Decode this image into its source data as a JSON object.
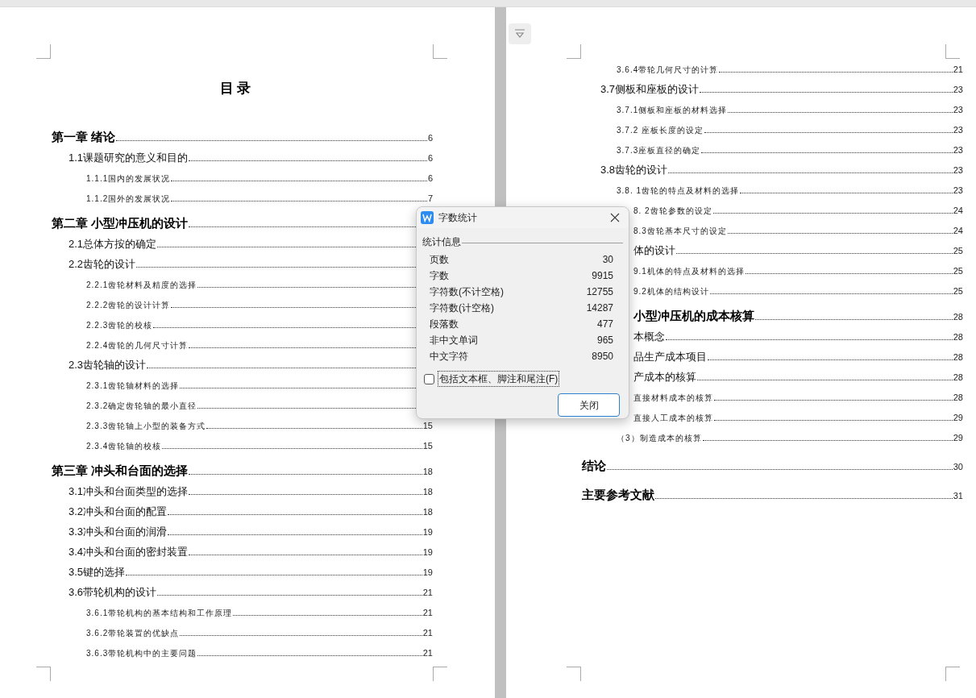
{
  "left_page": {
    "title": "目 录",
    "chapters": [
      {
        "title": "第一章  绪论",
        "page": "6",
        "children": [
          {
            "title": "1.1课题研究的意义和目的",
            "page": "6",
            "children": [
              {
                "title": "1.1.1国内的发展状况",
                "page": "6"
              },
              {
                "title": "1.1.2国外的发展状况",
                "page": "7"
              }
            ]
          }
        ]
      },
      {
        "title": "第二章  小型冲压机的设计",
        "children": [
          {
            "title": "2.1总体方按的确定"
          },
          {
            "title": "2.2齿轮的设计",
            "children": [
              {
                "title": "2.2.1齿轮材料及精度的选择"
              },
              {
                "title": "2.2.2齿轮的设计计算"
              },
              {
                "title": "2.2.3齿轮的校核"
              },
              {
                "title": "2.2.4齿轮的几何尺寸计算"
              }
            ]
          },
          {
            "title": "2.3齿轮轴的设计",
            "children": [
              {
                "title": "2.3.1齿轮轴材料的选择"
              },
              {
                "title": "2.3.2确定齿轮轴的最小直径"
              },
              {
                "title": "2.3.3齿轮轴上小型的装备方式",
                "page": "15"
              },
              {
                "title": "2.3.4齿轮轴的校核",
                "page": "15"
              }
            ]
          }
        ]
      },
      {
        "title": "第三章  冲头和台面的选择",
        "page": "18",
        "children": [
          {
            "title": "3.1冲头和台面类型的选择",
            "page": "18"
          },
          {
            "title": "3.2冲头和台面的配置",
            "page": "18"
          },
          {
            "title": "3.3冲头和台面的润滑",
            "page": "19"
          },
          {
            "title": "3.4冲头和台面的密封装置",
            "page": "19"
          },
          {
            "title": "3.5键的选择",
            "page": "19"
          },
          {
            "title": "3.6带轮机构的设计",
            "page": "21",
            "children": [
              {
                "title": "3.6.1带轮机构的基本结构和工作原理",
                "page": "21"
              },
              {
                "title": "3.6.2带轮装置的优缺点",
                "page": "21"
              },
              {
                "title": "3.6.3带轮机构中的主要问题",
                "page": "21"
              }
            ]
          }
        ]
      }
    ]
  },
  "right_page": {
    "continued_subsections": [
      {
        "title": "3.6.4带轮几何尺寸的计算",
        "page": "21"
      }
    ],
    "continued_sections": [
      {
        "title": "3.7侧板和座板的设计",
        "page": "23",
        "children": [
          {
            "title": "3.7.1侧板和座板的材料选择",
            "page": "23"
          },
          {
            "title": "3.7.2 座板长度的设定",
            "page": "23"
          },
          {
            "title": "3.7.3座板直径的确定",
            "page": "23"
          }
        ]
      },
      {
        "title": "3.8齿轮的设计",
        "page": "23",
        "children": [
          {
            "title": "3.8. 1齿轮的特点及材料的选择",
            "page": "23"
          },
          {
            "title": "8. 2齿轮参数的设定",
            "page": "24",
            "kind": "partial"
          },
          {
            "title": "8.3齿轮基本尺寸的设定",
            "page": "24",
            "kind": "partial"
          }
        ]
      },
      {
        "title": "体的设计",
        "page": "25",
        "kind": "partial",
        "children": [
          {
            "title": "9.1机体的特点及材料的选择",
            "page": "25",
            "kind": "partial"
          },
          {
            "title": "9.2机体的结构设计",
            "page": "25",
            "kind": "partial"
          }
        ]
      }
    ],
    "chapters": [
      {
        "title": "小型冲压机的成本核算",
        "page": "28",
        "kind": "partial",
        "children": [
          {
            "title": "本概念",
            "page": "28",
            "kind": "partial"
          },
          {
            "title": "品生产成本项目",
            "page": "28",
            "kind": "partial"
          },
          {
            "title": "产成本的核算",
            "page": "28",
            "kind": "partial",
            "children": [
              {
                "title": "直接材料成本的核算",
                "page": "28",
                "kind": "partial"
              },
              {
                "title": "直接人工成本的核算",
                "page": "29",
                "kind": "partial"
              },
              {
                "title": "（3）制造成本的核算",
                "page": "29"
              }
            ]
          }
        ]
      },
      {
        "title": "结论",
        "page": "30"
      },
      {
        "title": "主要参考文献",
        "page": "31"
      }
    ]
  },
  "dialog": {
    "title": "字数统计",
    "group_label": "统计信息",
    "stats": [
      {
        "label": "页数",
        "value": "30"
      },
      {
        "label": "字数",
        "value": "9915"
      },
      {
        "label": "字符数(不计空格)",
        "value": "12755"
      },
      {
        "label": "字符数(计空格)",
        "value": "14287"
      },
      {
        "label": "段落数",
        "value": "477"
      },
      {
        "label": "非中文单词",
        "value": "965"
      },
      {
        "label": "中文字符",
        "value": "8950"
      }
    ],
    "checkbox": {
      "label": "包括文本框、脚注和尾注(F)",
      "checked": false
    },
    "close_button": "关闭"
  }
}
